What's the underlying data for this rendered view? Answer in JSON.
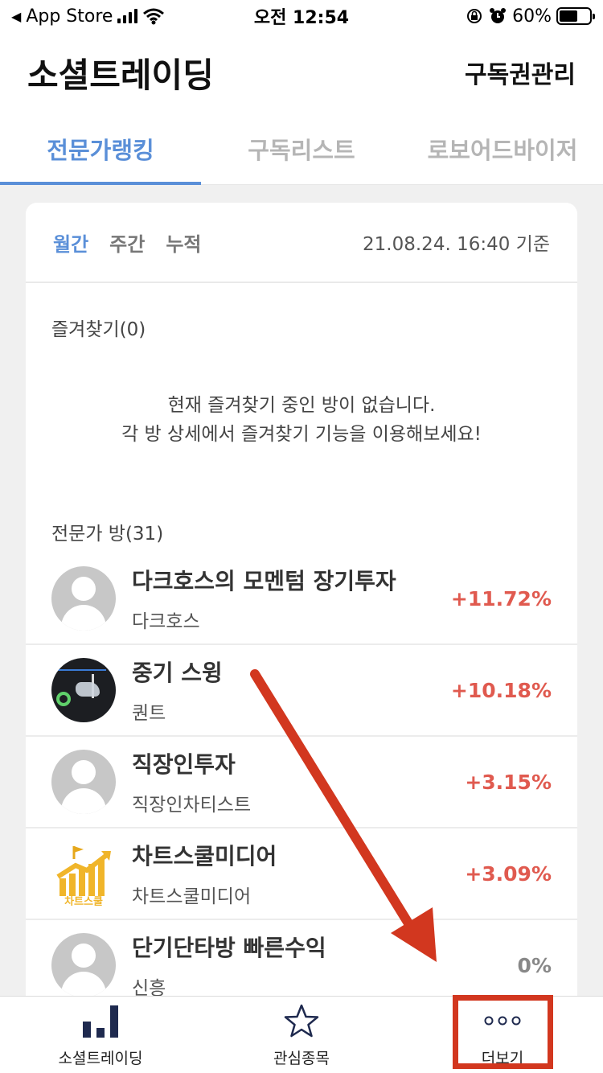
{
  "status_bar": {
    "back_app": "App Store",
    "time": "오전 12:54",
    "battery": "60%",
    "battery_level": 0.6
  },
  "header": {
    "title": "소셜트레이딩",
    "manage_link": "구독권관리"
  },
  "tabs": [
    {
      "label": "전문가랭킹",
      "active": true
    },
    {
      "label": "구독리스트",
      "active": false
    },
    {
      "label": "로보어드바이저",
      "active": false
    }
  ],
  "periods": [
    {
      "label": "월간",
      "active": true
    },
    {
      "label": "주간",
      "active": false
    },
    {
      "label": "누적",
      "active": false
    }
  ],
  "timestamp": "21.08.24. 16:40 기준",
  "favorites": {
    "label": "즐겨찾기(0)",
    "empty_line1": "현재 즐겨찾기 중인 방이 없습니다.",
    "empty_line2": "각 방 상세에서 즐겨찾기 기능을 이용해보세요!"
  },
  "experts": {
    "label": "전문가 방(31)",
    "rooms": [
      {
        "title": "다크호스의 모멘텀 장기투자",
        "owner": "다크호스",
        "return": "+11.72%",
        "avatar": "default"
      },
      {
        "title": "중기 스윙",
        "owner": "퀀트",
        "return": "+10.18%",
        "avatar": "dark"
      },
      {
        "title": "직장인투자",
        "owner": "직장인차티스트",
        "return": "+3.15%",
        "avatar": "default"
      },
      {
        "title": "차트스쿨미디어",
        "owner": "차트스쿨미디어",
        "return": "+3.09%",
        "avatar": "logo",
        "logo_text": "차트스쿨"
      },
      {
        "title": "단기단타방 빠른수익",
        "owner": "신흥",
        "return": "0%",
        "avatar": "default"
      }
    ]
  },
  "bottom_nav": [
    {
      "label": "소셜트레이딩",
      "icon": "bar-chart-icon"
    },
    {
      "label": "관심종목",
      "icon": "star-icon"
    },
    {
      "label": "더보기",
      "icon": "more-dots-icon"
    }
  ],
  "colors": {
    "accent": "#5a8fd8",
    "positive": "#e05a4f",
    "annotation": "#d2371f",
    "nav_icon": "#1f2a4f"
  }
}
